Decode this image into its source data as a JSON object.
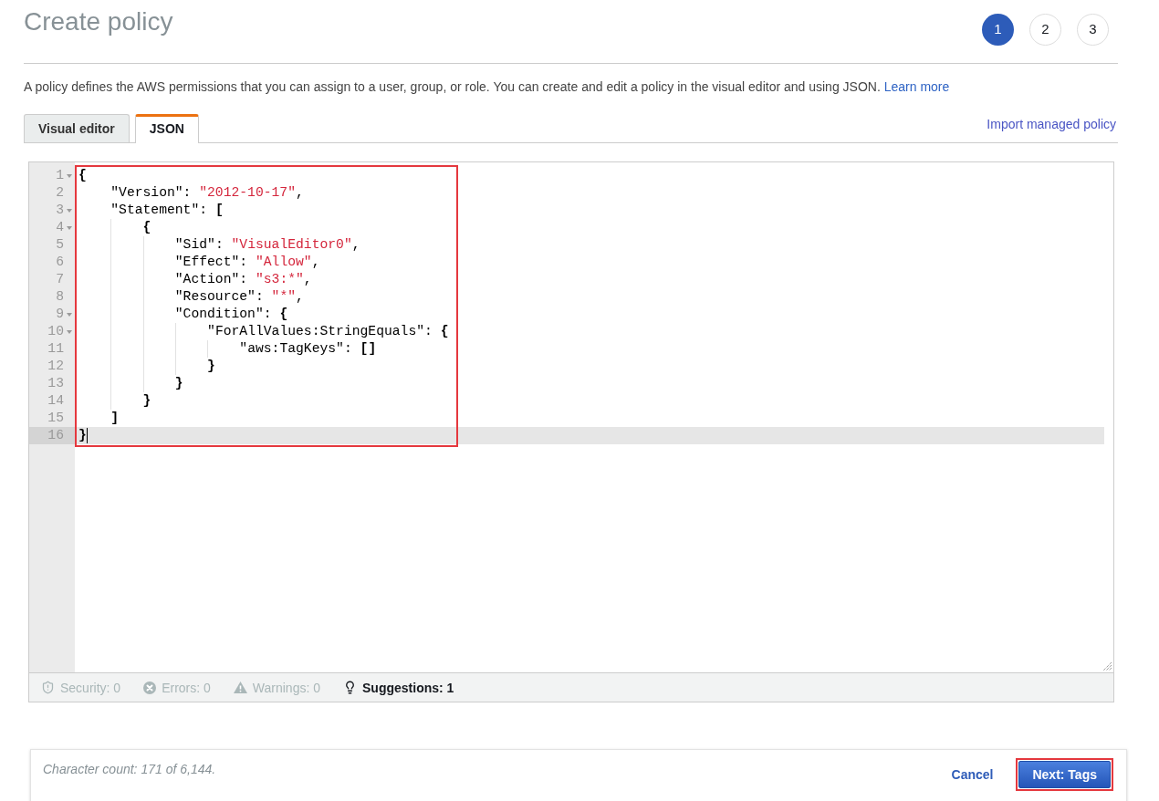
{
  "page_title": "Create policy",
  "steps": [
    {
      "label": "1",
      "selected": true
    },
    {
      "label": "2",
      "selected": false
    },
    {
      "label": "3",
      "selected": false
    }
  ],
  "description": {
    "text": "A policy defines the AWS permissions that you can assign to a user, group, or role. You can create and edit a policy in the visual editor and using JSON.",
    "link": "Learn more"
  },
  "tabs": [
    {
      "label": "Visual editor",
      "selected": false
    },
    {
      "label": "JSON",
      "selected": true
    }
  ],
  "import_link": "Import managed policy",
  "editor": {
    "highlighted": true,
    "lines": [
      {
        "number": "1",
        "foldable": true,
        "active": false,
        "tokens": [
          {
            "kind": "paren",
            "text": "{"
          }
        ]
      },
      {
        "number": "2",
        "foldable": false,
        "active": false,
        "tokens": [
          {
            "kind": "key",
            "text": "    \"Version\""
          },
          {
            "kind": "punct",
            "text": ": "
          },
          {
            "kind": "string",
            "text": "\"2012-10-17\""
          },
          {
            "kind": "punct",
            "text": ","
          }
        ]
      },
      {
        "number": "3",
        "foldable": true,
        "active": false,
        "tokens": [
          {
            "kind": "key",
            "text": "    \"Statement\""
          },
          {
            "kind": "punct",
            "text": ": "
          },
          {
            "kind": "paren",
            "text": "["
          }
        ]
      },
      {
        "number": "4",
        "foldable": true,
        "active": false,
        "tokens": [
          {
            "kind": "paren",
            "text": "        {"
          }
        ]
      },
      {
        "number": "5",
        "foldable": false,
        "active": false,
        "tokens": [
          {
            "kind": "key",
            "text": "            \"Sid\""
          },
          {
            "kind": "punct",
            "text": ": "
          },
          {
            "kind": "string",
            "text": "\"VisualEditor0\""
          },
          {
            "kind": "punct",
            "text": ","
          }
        ]
      },
      {
        "number": "6",
        "foldable": false,
        "active": false,
        "tokens": [
          {
            "kind": "key",
            "text": "            \"Effect\""
          },
          {
            "kind": "punct",
            "text": ": "
          },
          {
            "kind": "string",
            "text": "\"Allow\""
          },
          {
            "kind": "punct",
            "text": ","
          }
        ]
      },
      {
        "number": "7",
        "foldable": false,
        "active": false,
        "tokens": [
          {
            "kind": "key",
            "text": "            \"Action\""
          },
          {
            "kind": "punct",
            "text": ": "
          },
          {
            "kind": "string",
            "text": "\"s3:*\""
          },
          {
            "kind": "punct",
            "text": ","
          }
        ]
      },
      {
        "number": "8",
        "foldable": false,
        "active": false,
        "tokens": [
          {
            "kind": "key",
            "text": "            \"Resource\""
          },
          {
            "kind": "punct",
            "text": ": "
          },
          {
            "kind": "string",
            "text": "\"*\""
          },
          {
            "kind": "punct",
            "text": ","
          }
        ]
      },
      {
        "number": "9",
        "foldable": true,
        "active": false,
        "tokens": [
          {
            "kind": "key",
            "text": "            \"Condition\""
          },
          {
            "kind": "punct",
            "text": ": "
          },
          {
            "kind": "paren",
            "text": "{"
          }
        ]
      },
      {
        "number": "10",
        "foldable": true,
        "active": false,
        "tokens": [
          {
            "kind": "key",
            "text": "                \"ForAllValues:StringEquals\""
          },
          {
            "kind": "punct",
            "text": ": "
          },
          {
            "kind": "paren",
            "text": "{"
          }
        ]
      },
      {
        "number": "11",
        "foldable": false,
        "active": false,
        "tokens": [
          {
            "kind": "key",
            "text": "                    \"aws:TagKeys\""
          },
          {
            "kind": "punct",
            "text": ": "
          },
          {
            "kind": "paren",
            "text": "[]"
          }
        ]
      },
      {
        "number": "12",
        "foldable": false,
        "active": false,
        "tokens": [
          {
            "kind": "paren",
            "text": "                }"
          }
        ]
      },
      {
        "number": "13",
        "foldable": false,
        "active": false,
        "tokens": [
          {
            "kind": "paren",
            "text": "            }"
          }
        ]
      },
      {
        "number": "14",
        "foldable": false,
        "active": false,
        "tokens": [
          {
            "kind": "paren",
            "text": "        }"
          }
        ]
      },
      {
        "number": "15",
        "foldable": false,
        "active": false,
        "tokens": [
          {
            "kind": "paren",
            "text": "    ]"
          }
        ]
      },
      {
        "number": "16",
        "foldable": false,
        "active": true,
        "tokens": [
          {
            "kind": "paren",
            "text": "}"
          }
        ]
      }
    ]
  },
  "status_bar": {
    "items": [
      {
        "kind": "security",
        "label": "Security: 0",
        "disabled": true
      },
      {
        "kind": "errors",
        "label": "Errors: 0",
        "disabled": true
      },
      {
        "kind": "warnings",
        "label": "Warnings: 0",
        "disabled": true
      },
      {
        "kind": "suggestions",
        "label": "Suggestions: 1",
        "disabled": false
      }
    ]
  },
  "footer": {
    "character_count": "Character count: 171 of 6,144.",
    "cancel": "Cancel",
    "next_button": {
      "label": "Next: Tags",
      "highlighted": true
    }
  }
}
